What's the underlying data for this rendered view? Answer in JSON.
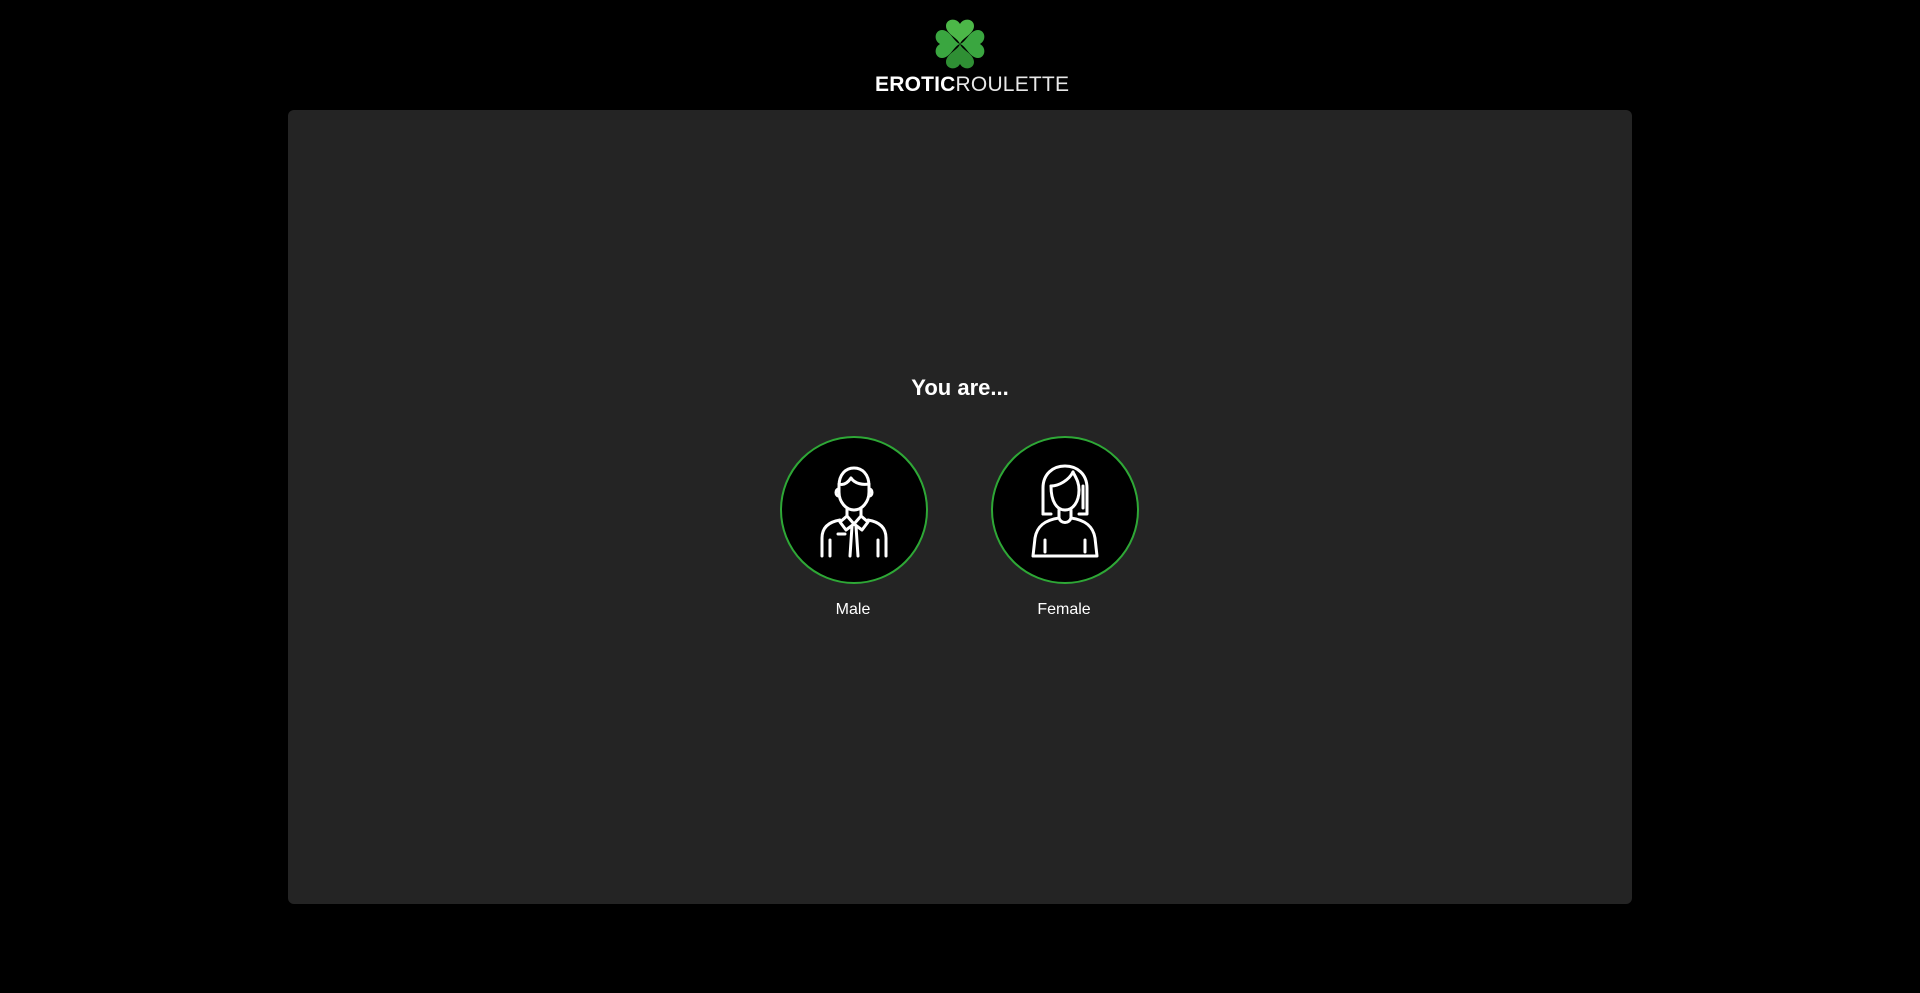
{
  "header": {
    "logo_bold": "EROTIC",
    "logo_light": "ROULETTE",
    "logo_icon": "clover-icon"
  },
  "gender_select": {
    "title": "You are...",
    "options": [
      {
        "label": "Male",
        "icon": "male-avatar-icon"
      },
      {
        "label": "Female",
        "icon": "female-avatar-icon"
      }
    ]
  },
  "colors": {
    "page_background": "#000000",
    "panel_background": "#242424",
    "accent_green": "#2ea836",
    "clover_light": "#4cb748",
    "clover_dark": "#2f8f34",
    "text": "#ffffff"
  }
}
